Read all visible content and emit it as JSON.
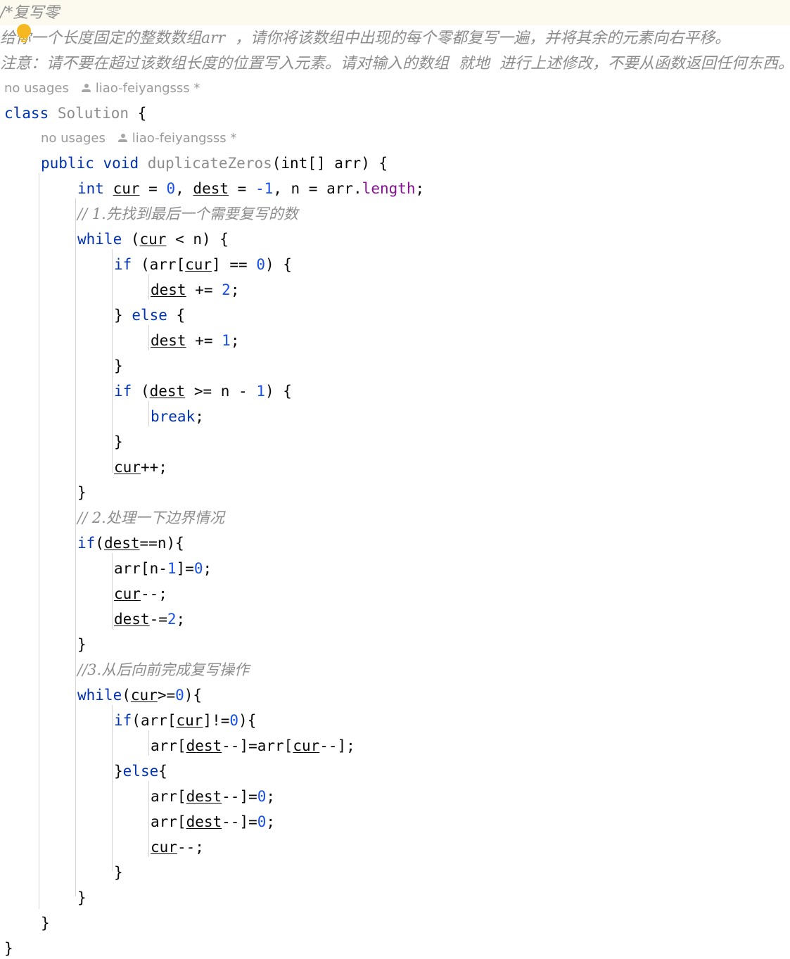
{
  "editor": {
    "language": "Java",
    "caret_line_bg": "#fcfaef",
    "colors": {
      "keyword": "#0033b3",
      "number": "#1750eb",
      "comment": "#8c8c8c",
      "field": "#871094",
      "identifier": "#080808",
      "class_name": "#8c8c8c",
      "inlay_hint": "#9a9a9a",
      "indent_guide": "#d5d5d5",
      "bulb": "#f5b820",
      "background": "#ffffff"
    },
    "block_comment": {
      "line1": "/*复写零",
      "line2": "给你一个长度固定的整数数组arr  ，请你将该数组中出现的每个零都复写一遍，并将其余的元素向右平移。",
      "line3": "注意：请不要在超过该数组长度的位置写入元素。请对输入的数组  就地  进行上述修改，不要从函数返回任何东西。*/"
    },
    "hints": {
      "class_hint": {
        "usages": "no usages",
        "author": "liao-feiyangsss *"
      },
      "method_hint": {
        "usages": "no usages",
        "author": "liao-feiyangsss *"
      }
    },
    "icons": {
      "intention_bulb": "lightbulb-icon",
      "author": "person-icon"
    },
    "code": {
      "class_decl_kw": "class",
      "class_name": "Solution",
      "class_brace": "{",
      "method_mod": "public",
      "method_ret": "void",
      "method_name": "duplicateZeros",
      "method_params": "(int[] arr) {",
      "decl_int": "int",
      "decl_cur": "cur",
      "decl_eq0": " = ",
      "decl_zero": "0",
      "decl_comma": ", ",
      "decl_dest": "dest",
      "decl_eq1": " = ",
      "decl_neg1": "-1",
      "decl_comma2": ", n = arr.",
      "decl_length": "length",
      "decl_semi": ";",
      "comment1": "// 1.先找到最后一个需要复写的数",
      "comment2": "// 2.处理一下边界情况",
      "comment3": "//3.从后向前完成复写操作",
      "kw_while": "while",
      "kw_if": "if",
      "kw_else": "else",
      "kw_break": "break",
      "w1_cond_open": " (",
      "w1_cur": "cur",
      "w1_cond_close": " < n) {",
      "if1_open": " (arr[",
      "if1_cur": "cur",
      "if1_mid": "] == ",
      "if1_zero": "0",
      "if1_close": ") {",
      "dest_pe2_name": "dest",
      "dest_pe2_op": " += ",
      "dest_pe2_num": "2",
      "dest_pe2_semi": ";",
      "else1": "} else {",
      "dest_pe1_name": "dest",
      "dest_pe1_op": " += ",
      "dest_pe1_num": "1",
      "dest_pe1_semi": ";",
      "close_brace": "}",
      "if2_open": " (",
      "if2_dest": "dest",
      "if2_mid": " >= n - ",
      "if2_one": "1",
      "if2_close": ") {",
      "break_semi": ";",
      "cur_inc_name": "cur",
      "cur_inc_op": "++;",
      "if3_open": "(",
      "if3_dest": "dest",
      "if3_close": "==n){",
      "arr_n1_pre": "arr[n-",
      "arr_n1_one": "1",
      "arr_n1_mid": "]=",
      "arr_n1_zero": "0",
      "arr_n1_semi": ";",
      "cur_dec_name": "cur",
      "cur_dec_op": "--;",
      "dest_me2_name": "dest",
      "dest_me2_op": "-=",
      "dest_me2_num": "2",
      "dest_me2_semi": ";",
      "w2_open": "(",
      "w2_cur": "cur",
      "w2_mid": ">=",
      "w2_zero": "0",
      "w2_close": "){",
      "if4_open": "(arr[",
      "if4_cur": "cur",
      "if4_mid": "]!=",
      "if4_zero": "0",
      "if4_close": "){",
      "assign_pre": "arr[",
      "assign_dest": "dest",
      "assign_mid": "--]=arr[",
      "assign_cur": "cur",
      "assign_post": "--];",
      "else2_open": "}",
      "else2_close": "{",
      "arrdest_pre": "arr[",
      "arrdest_name": "dest",
      "arrdest_mid": "--]=",
      "arrdest_zero": "0",
      "arrdest_semi": ";",
      "cur_dec2_name": "cur",
      "cur_dec2_op": "--;"
    }
  }
}
